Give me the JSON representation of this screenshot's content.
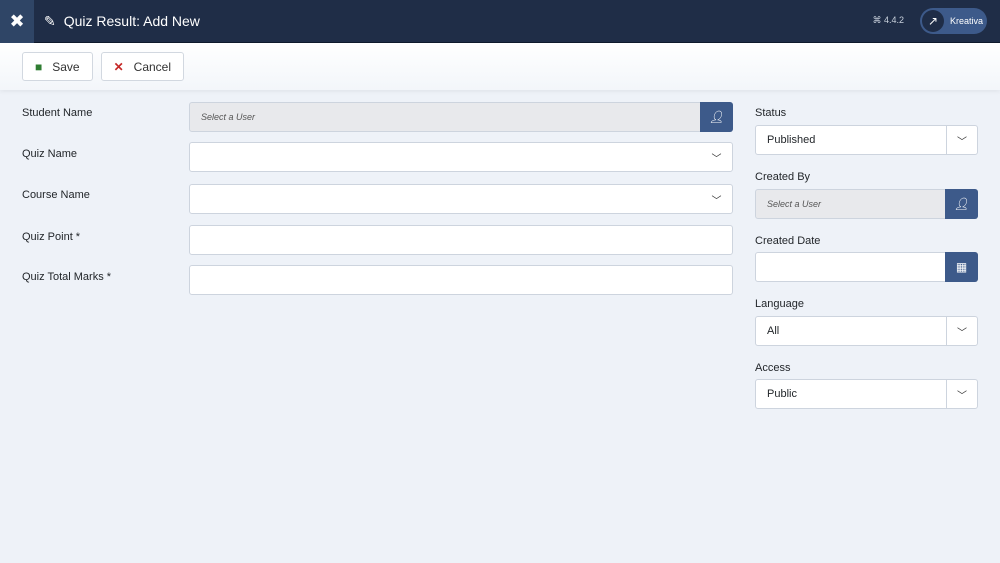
{
  "header": {
    "title": "Quiz Result: Add New",
    "version": "4.4.2",
    "user": "Kreativa"
  },
  "toolbar": {
    "save": "Save",
    "cancel": "Cancel"
  },
  "form": {
    "student_name": {
      "label": "Student Name",
      "placeholder": "Select a User"
    },
    "quiz_name": {
      "label": "Quiz Name",
      "value": ""
    },
    "course_name": {
      "label": "Course Name",
      "value": ""
    },
    "quiz_point": {
      "label": "Quiz Point *",
      "value": ""
    },
    "quiz_total_marks": {
      "label": "Quiz Total Marks *",
      "value": ""
    }
  },
  "side": {
    "status": {
      "label": "Status",
      "value": "Published"
    },
    "created_by": {
      "label": "Created By",
      "placeholder": "Select a User"
    },
    "created_date": {
      "label": "Created Date",
      "value": ""
    },
    "language": {
      "label": "Language",
      "value": "All"
    },
    "access": {
      "label": "Access",
      "value": "Public"
    }
  }
}
